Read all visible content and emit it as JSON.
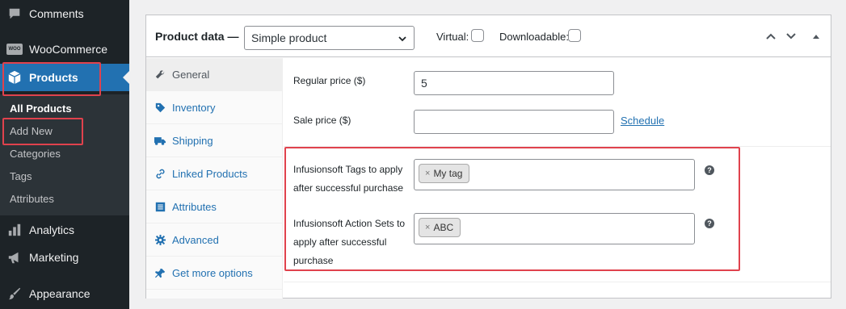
{
  "sidebar": {
    "items": [
      {
        "label": "Comments",
        "icon": "comment-icon"
      },
      {
        "label": "WooCommerce",
        "icon": "woocommerce-icon",
        "icon_text": "WOO"
      },
      {
        "label": "Products",
        "icon": "product-box-icon"
      },
      {
        "label": "Analytics",
        "icon": "bar-chart-icon"
      },
      {
        "label": "Marketing",
        "icon": "megaphone-icon"
      },
      {
        "label": "Appearance",
        "icon": "paintbrush-icon"
      }
    ],
    "submenu": [
      "All Products",
      "Add New",
      "Categories",
      "Tags",
      "Attributes"
    ]
  },
  "panel": {
    "title": "Product data —",
    "product_type": "Simple product",
    "virtual_label": "Virtual:",
    "downloadable_label": "Downloadable:",
    "virtual_checked": false,
    "downloadable_checked": false
  },
  "tabs": [
    {
      "label": "General",
      "icon": "wrench-icon"
    },
    {
      "label": "Inventory",
      "icon": "tag-icon"
    },
    {
      "label": "Shipping",
      "icon": "truck-icon"
    },
    {
      "label": "Linked Products",
      "icon": "link-icon"
    },
    {
      "label": "Attributes",
      "icon": "list-icon"
    },
    {
      "label": "Advanced",
      "icon": "gear-icon"
    },
    {
      "label": "Get more options",
      "icon": "plugin-icon"
    }
  ],
  "general": {
    "regular_price_label": "Regular price ($)",
    "regular_price_value": "5",
    "sale_price_label": "Sale price ($)",
    "sale_price_value": "",
    "schedule_link": "Schedule",
    "tags_label_line1": "Infusionsoft Tags to apply",
    "tags_label_line2": "after successful purchase",
    "tag_token": "My tag",
    "actions_label_line1": "Infusionsoft Action Sets to",
    "actions_label_line2": "apply after successful",
    "actions_label_line3": "purchase",
    "action_token": "ABC",
    "token_remove": "×",
    "help": "?"
  },
  "colors": {
    "sidebar_bg": "#1d2327",
    "accent": "#2271b1",
    "highlight": "#e0424d"
  }
}
